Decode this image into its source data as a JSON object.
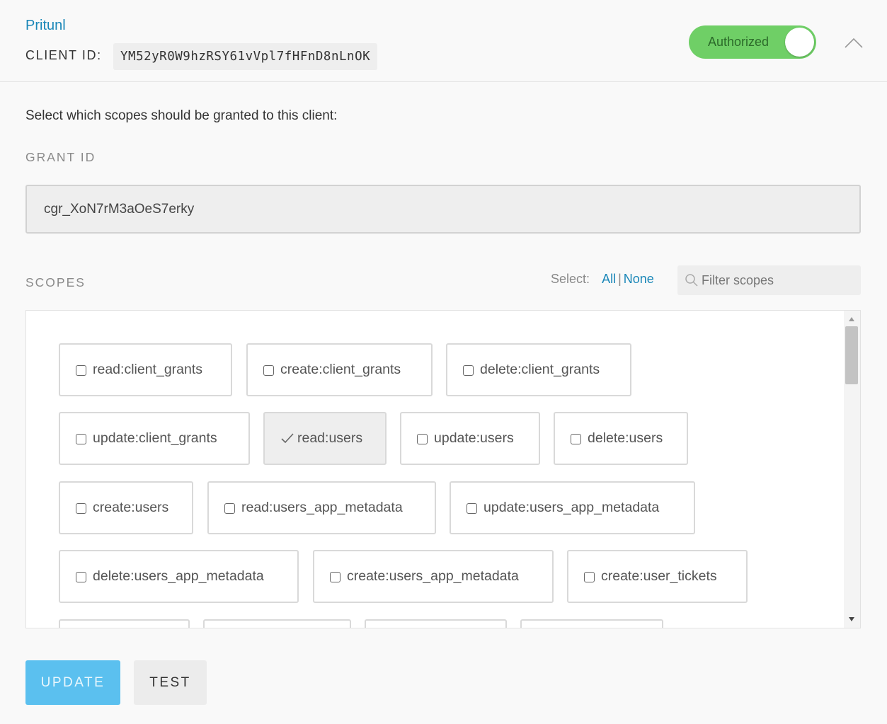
{
  "header": {
    "app_name": "Pritunl",
    "client_id_label": "CLIENT ID:",
    "client_id_value": "YM52yR0W9hzRSY61vVpl7fHFnD8nLnOK",
    "toggle_label": "Authorized",
    "toggle_on": true
  },
  "body": {
    "instructions": "Select which scopes should be granted to this client:",
    "grant_label": "GRANT ID",
    "grant_value": "cgr_XoN7rM3aOeS7erky",
    "scopes_label": "SCOPES",
    "select_label": "Select:",
    "select_all": "All",
    "select_sep": "|",
    "select_none": "None",
    "filter_placeholder": "Filter scopes"
  },
  "scopes": [
    {
      "label": "read:client_grants",
      "checked": false
    },
    {
      "label": "create:client_grants",
      "checked": false
    },
    {
      "label": "delete:client_grants",
      "checked": false
    },
    {
      "label": "update:client_grants",
      "checked": false
    },
    {
      "label": "read:users",
      "checked": true
    },
    {
      "label": "update:users",
      "checked": false
    },
    {
      "label": "delete:users",
      "checked": false
    },
    {
      "label": "create:users",
      "checked": false
    },
    {
      "label": "read:users_app_metadata",
      "checked": false
    },
    {
      "label": "update:users_app_metadata",
      "checked": false
    },
    {
      "label": "delete:users_app_metadata",
      "checked": false
    },
    {
      "label": "create:users_app_metadata",
      "checked": false
    },
    {
      "label": "create:user_tickets",
      "checked": false
    }
  ],
  "buttons": {
    "update": "UPDATE",
    "test": "TEST"
  },
  "colors": {
    "accent_link": "#1a87b8",
    "toggle_on": "#6fcf66",
    "update_button": "#5bc0ef"
  }
}
